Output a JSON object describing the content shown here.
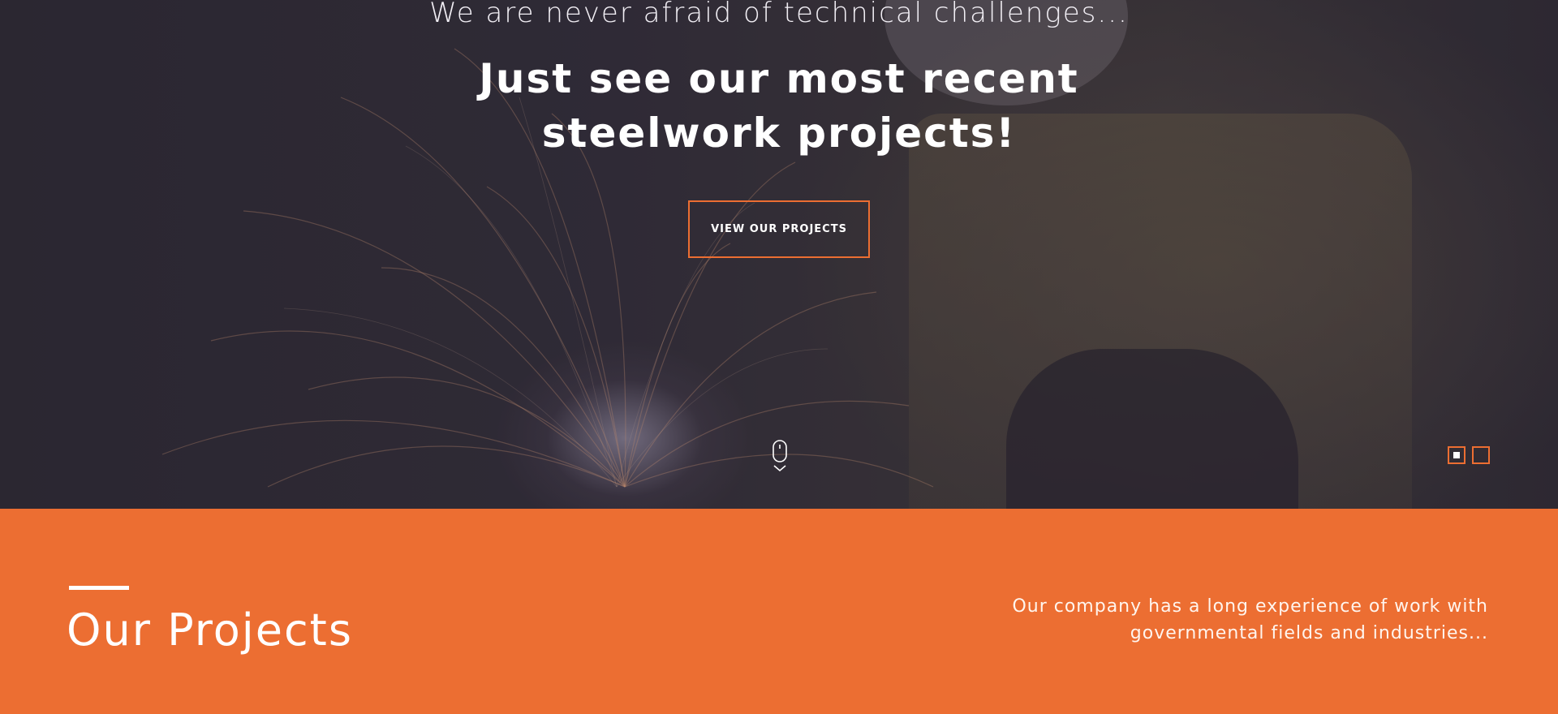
{
  "hero": {
    "subtitle": "We are never afraid of technical challenges...",
    "title": "Just see our most recent steelwork projects!",
    "button_label": "VIEW OUR PROJECTS",
    "slider": {
      "total_slides": 2,
      "active_slide": 1
    },
    "scroll_icon": "mouse-scroll-icon"
  },
  "projects": {
    "title": "Our Projects",
    "description": "Our company has a long experience of work with governmental fields and industries..."
  },
  "colors": {
    "accent": "#ec6e32",
    "hero_bg": "#2e2a35",
    "text_light": "#ffffff"
  }
}
